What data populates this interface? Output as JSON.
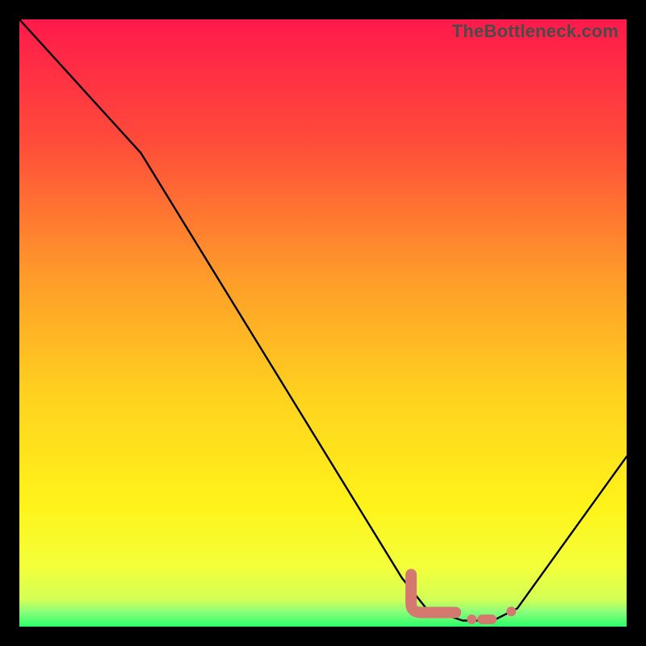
{
  "watermark": "TheBottleneck.com",
  "chart_data": {
    "type": "line",
    "title": "",
    "xlabel": "",
    "ylabel": "",
    "xlim": [
      0,
      100
    ],
    "ylim": [
      0,
      100
    ],
    "grid": false,
    "legend": false,
    "gradient_stops": [
      {
        "pos": 0.0,
        "color": "#ff1a4b"
      },
      {
        "pos": 0.2,
        "color": "#ff4b3a"
      },
      {
        "pos": 0.42,
        "color": "#ff9a2a"
      },
      {
        "pos": 0.62,
        "color": "#ffd21f"
      },
      {
        "pos": 0.8,
        "color": "#fff31a"
      },
      {
        "pos": 0.9,
        "color": "#f3ff3a"
      },
      {
        "pos": 0.955,
        "color": "#d4ff55"
      },
      {
        "pos": 0.975,
        "color": "#8dff7a"
      },
      {
        "pos": 1.0,
        "color": "#2bff6a"
      }
    ],
    "series": [
      {
        "name": "bottleneck-curve",
        "color": "#000000",
        "x": [
          0,
          20,
          63,
          67,
          73,
          78,
          82,
          100
        ],
        "y": [
          100,
          78,
          8,
          3,
          1,
          1,
          3,
          28
        ]
      }
    ],
    "markers": [
      {
        "shape": "rounded-L",
        "x": 66.5,
        "y": 3.0,
        "color": "#d5786f"
      },
      {
        "shape": "dot-small",
        "x": 74.5,
        "y": 1.2,
        "color": "#d5786f"
      },
      {
        "shape": "dash",
        "x": 77.0,
        "y": 1.2,
        "color": "#d5786f"
      },
      {
        "shape": "dot-small",
        "x": 81.0,
        "y": 2.5,
        "color": "#d5786f"
      }
    ]
  }
}
